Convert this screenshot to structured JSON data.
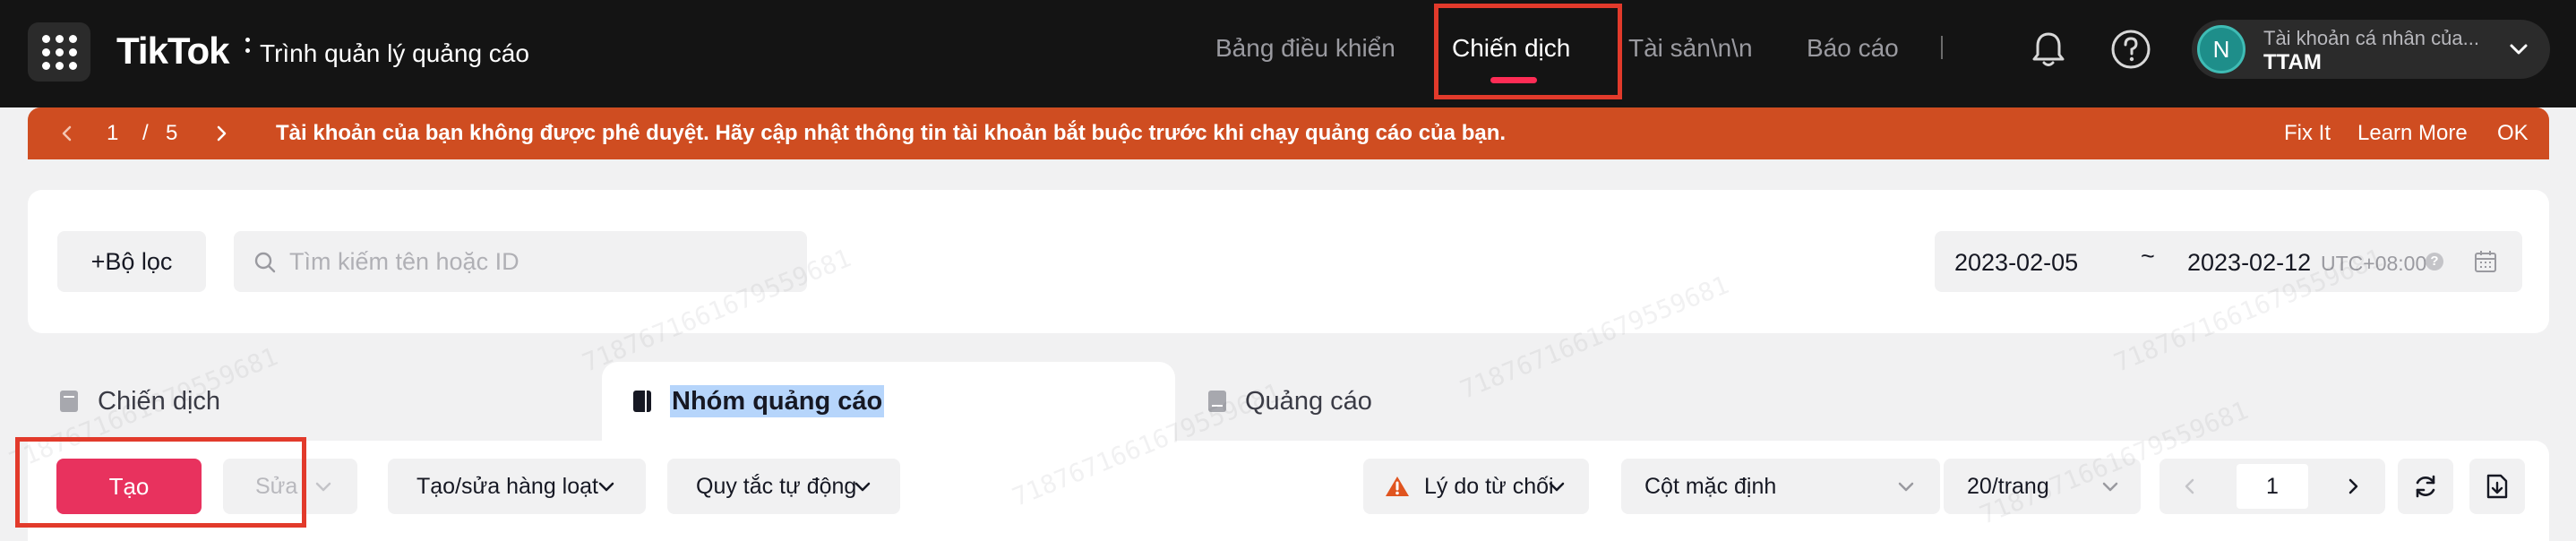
{
  "header": {
    "logo": "TikTok",
    "subtitle": "Trình quản lý quảng cáo",
    "nav": [
      {
        "label": "Bảng điều khiển",
        "active": false
      },
      {
        "label": "Chiến dịch",
        "active": true
      },
      {
        "label": "Tài sản\\n\\n",
        "active": false
      },
      {
        "label": "Báo cáo",
        "active": false
      }
    ],
    "account": {
      "avatar_letter": "N",
      "name": "Tài khoản cá nhân của...",
      "id": "TTAM"
    }
  },
  "banner": {
    "page_current": "1",
    "page_separator": "/",
    "page_total": "5",
    "message": "Tài khoản của bạn không được phê duyệt. Hãy cập nhật thông tin tài khoản bắt buộc trước khi chạy quảng cáo của bạn.",
    "fix_label": "Fix It",
    "learn_label": "Learn More",
    "ok_label": "OK",
    "color": "#cf4d21"
  },
  "filters": {
    "filter_label": "+Bộ lọc",
    "search_placeholder": "Tìm kiếm tên hoặc ID",
    "date_start": "2023-02-05",
    "date_separator": "~",
    "date_end": "2023-02-12",
    "timezone": "UTC+08:00",
    "timezone_help": "?"
  },
  "tabs": [
    {
      "label": "Chiến dịch",
      "active": false
    },
    {
      "label": "Nhóm quảng cáo",
      "active": true
    },
    {
      "label": "Quảng cáo",
      "active": false
    }
  ],
  "toolbar": {
    "create_label": "Tạo",
    "edit_label": "Sửa",
    "bulk_label": "Tạo/sửa hàng loạt",
    "rules_label": "Quy tắc tự động",
    "reject_label": "Lý do từ chối",
    "columns_label": "Cột mặc định",
    "per_page_label": "20/trang",
    "page_number": "1"
  },
  "watermark_text": "7187671661679559681",
  "colors": {
    "accent": "#fe2c55",
    "create_button": "#e8325e",
    "warning": "#e0541f",
    "highlight": "#e23a2b"
  }
}
